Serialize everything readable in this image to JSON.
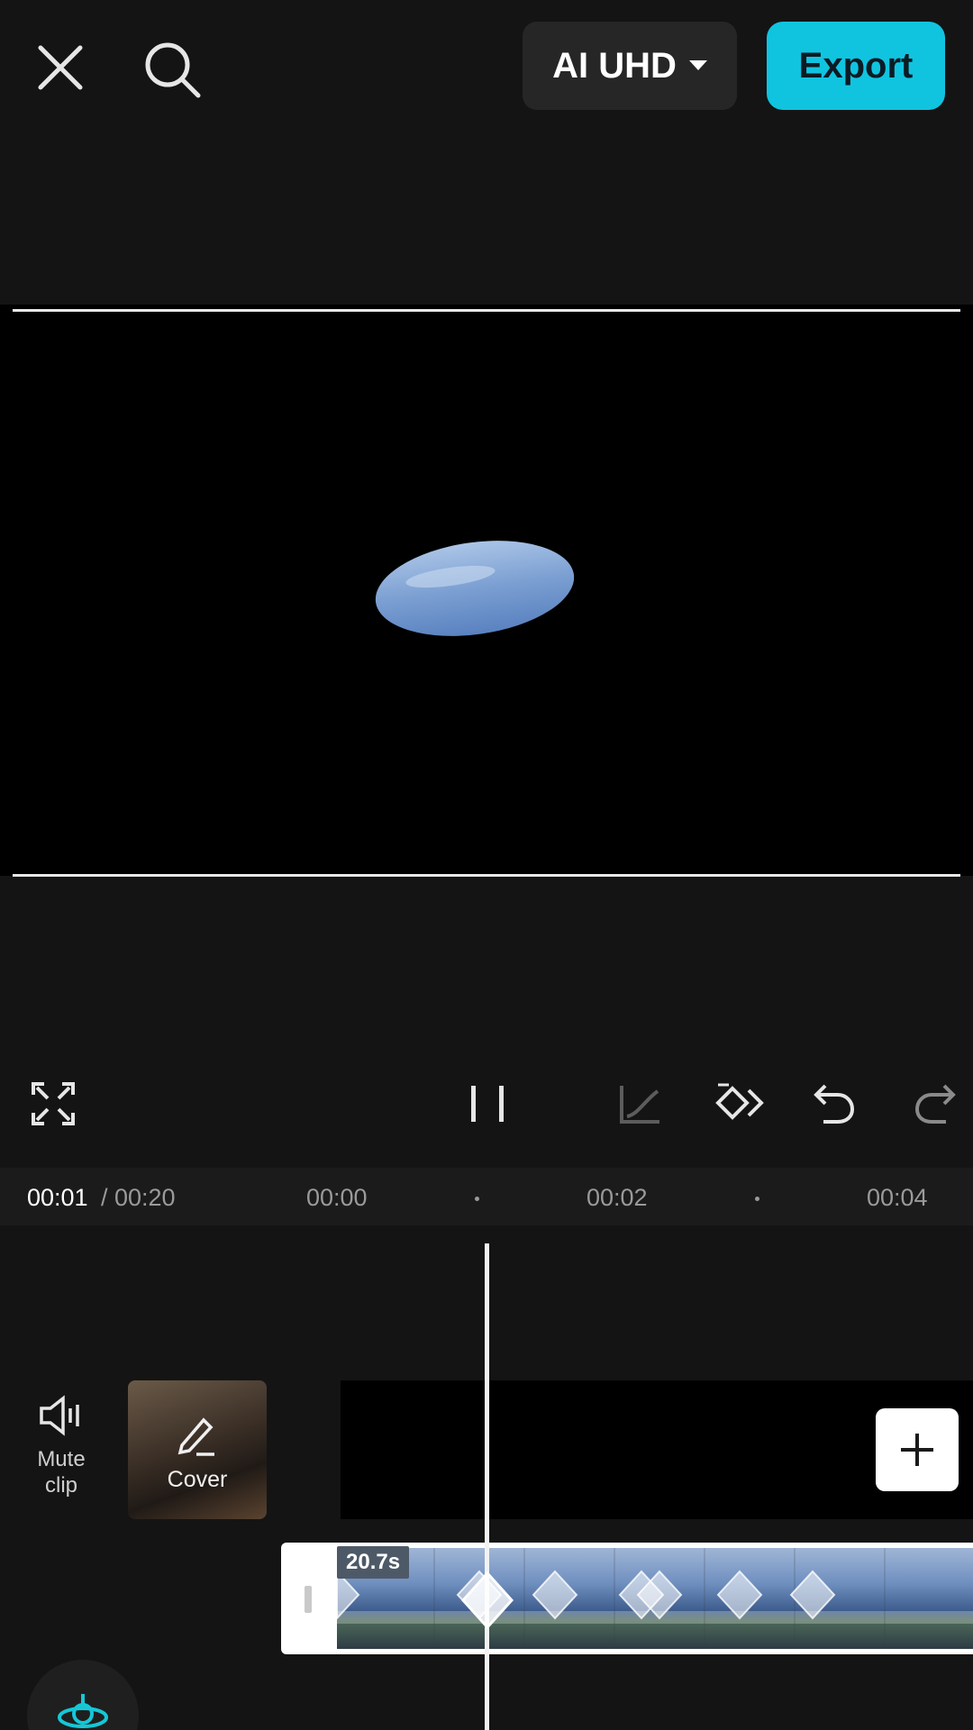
{
  "topbar": {
    "quality_label": "AI UHD",
    "export_label": "Export"
  },
  "ruler": {
    "current_time": "00:01",
    "total_time": "/ 00:20",
    "ticks": [
      "00:00",
      "00:02",
      "00:04"
    ]
  },
  "timeline": {
    "mute_label_1": "Mute",
    "mute_label_2": "clip",
    "cover_label": "Cover",
    "clip_duration": "20.7s"
  },
  "colors": {
    "accent": "#10c4e0",
    "background": "#141414"
  }
}
